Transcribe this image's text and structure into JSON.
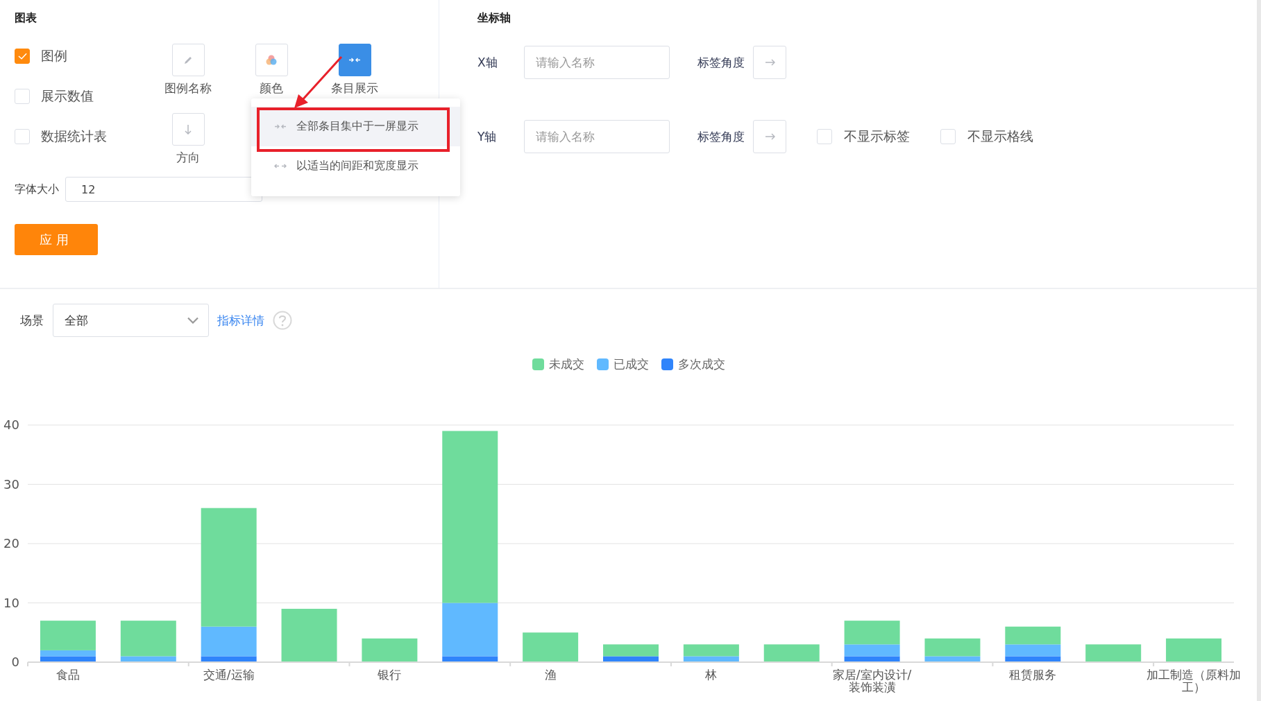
{
  "chart_settings": {
    "title": "图表",
    "options": [
      {
        "label": "图例",
        "checked": true
      },
      {
        "label": "展示数值",
        "checked": false
      },
      {
        "label": "数据统计表",
        "checked": false
      }
    ],
    "tools": [
      {
        "kind": "pencil",
        "label": "图例名称",
        "selected": false
      },
      {
        "kind": "colors",
        "label": "颜色",
        "selected": false
      },
      {
        "kind": "collapse",
        "label": "条目展示",
        "selected": true
      },
      {
        "kind": "down",
        "label": "方向",
        "selected": false
      }
    ],
    "font_size": {
      "label": "字体大小",
      "value": "12"
    },
    "apply_button": "应用",
    "display_menu": {
      "callout": true,
      "items": [
        {
          "kind": "collapse",
          "label": "全部条目集中于一屏显示",
          "selected": true
        },
        {
          "kind": "expand",
          "label": "以适当的间距和宽度显示",
          "selected": false
        }
      ]
    }
  },
  "axis_settings": {
    "title": "坐标轴",
    "axes": [
      {
        "label": "X轴",
        "placeholder": "请输入名称",
        "angle_label": "标签角度"
      },
      {
        "label": "Y轴",
        "placeholder": "请输入名称",
        "angle_label": "标签角度",
        "options": [
          {
            "label": "不显示标签",
            "checked": false
          },
          {
            "label": "不显示格线",
            "checked": false
          }
        ]
      }
    ]
  },
  "scene": {
    "label": "场景",
    "value": "全部",
    "link": "指标详情"
  },
  "chart": {
    "chart_data": {
      "type": "bar",
      "stacked": true,
      "categories": [
        "食品",
        null,
        "交通/运输",
        null,
        "银行",
        null,
        "渔",
        null,
        "林",
        null,
        "家居/室内设计/装饰装潢",
        null,
        "租赁服务",
        null,
        "加工制造（原料加工）"
      ],
      "grid": true,
      "ylim": [
        0,
        40
      ],
      "yticks": [
        0,
        10,
        20,
        30,
        40
      ],
      "series": [
        {
          "name": "未成交",
          "color": "#6fdc9c",
          "values": [
            5,
            6,
            20,
            9,
            4,
            29,
            5,
            2,
            2,
            3,
            4,
            3,
            3,
            3,
            4
          ]
        },
        {
          "name": "已成交",
          "color": "#60b9ff",
          "values": [
            1,
            1,
            5,
            0,
            0,
            9,
            0,
            0,
            1,
            0,
            2,
            1,
            2,
            0,
            0
          ]
        },
        {
          "name": "多次成交",
          "color": "#2f84fb",
          "values": [
            1,
            0,
            1,
            0,
            0,
            1,
            0,
            1,
            0,
            0,
            1,
            0,
            1,
            0,
            0
          ]
        }
      ]
    }
  }
}
